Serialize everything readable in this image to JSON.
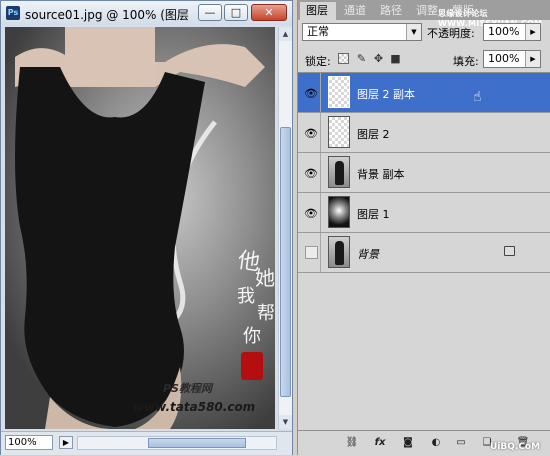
{
  "document_window": {
    "app_badge": "Ps",
    "title": "source01.jpg @ 100% (图层",
    "min_label": "—",
    "max_label": "□",
    "close_label": "✕",
    "zoom": "100%",
    "canvas_watermark_line1": "PS教程网",
    "canvas_watermark_line2": "www.tata580.com"
  },
  "layers_panel": {
    "tabs": [
      "图层",
      "通道",
      "路径",
      "调整",
      "蒙版"
    ],
    "header_watermark": "思缘设计论坛 WWW.MISSYUAN.COM",
    "blend_mode": "正常",
    "opacity_label": "不透明度:",
    "opacity_value": "100%",
    "lock_label": "锁定:",
    "fill_label": "填充:",
    "fill_value": "100%",
    "layers": [
      {
        "name": "图层 2 副本",
        "visible": true,
        "selected": true,
        "thumb": "transparent"
      },
      {
        "name": "图层 2",
        "visible": true,
        "selected": false,
        "thumb": "transparent"
      },
      {
        "name": "背景 副本",
        "visible": true,
        "selected": false,
        "thumb": "photo"
      },
      {
        "name": "图层 1",
        "visible": true,
        "selected": false,
        "thumb": "glow"
      },
      {
        "name": "背景",
        "visible": false,
        "selected": false,
        "thumb": "photo",
        "locked": true,
        "italic": true
      }
    ],
    "footer_watermark": "UiBQ.CoM"
  },
  "icons": {
    "eye": "eye-icon",
    "link": "link-icon",
    "fx": "fx",
    "mask": "mask-icon",
    "adjustment": "adjustment-icon",
    "group": "folder-icon",
    "new_layer": "new-layer-icon",
    "trash": "trash-icon"
  },
  "colors": {
    "selection": "#3d6fcb",
    "panel_bg": "#d6d6d6",
    "window_frame": "#d6dfe9"
  }
}
